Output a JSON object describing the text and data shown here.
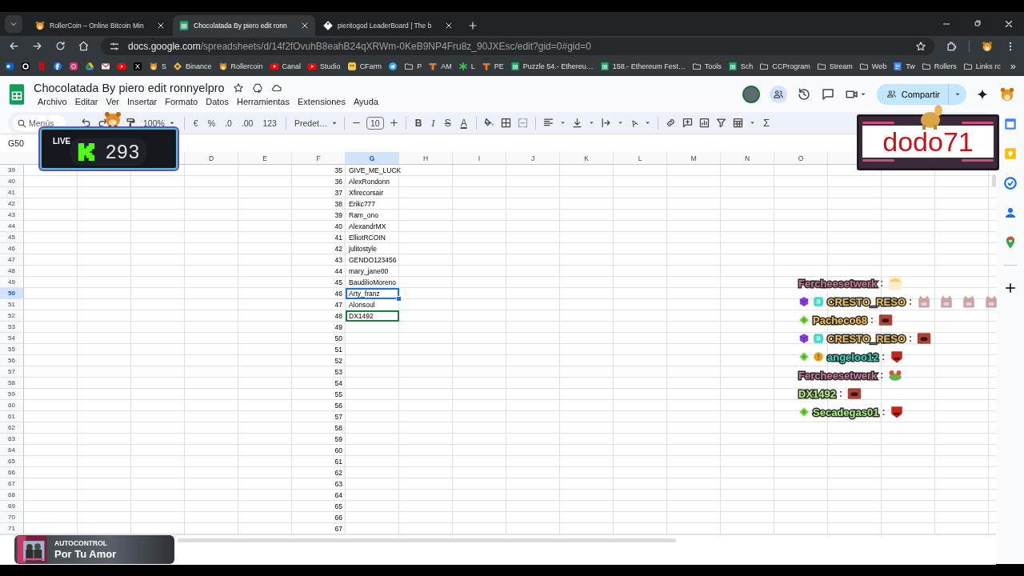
{
  "browser": {
    "tabs": [
      {
        "title": "RollerCoin – Online Bitcoin Min",
        "kind": "mascot",
        "selected": false
      },
      {
        "title": "Chocolatada By piero edit ronn",
        "kind": "sheet",
        "selected": true
      },
      {
        "title": "pieritogod LeaderBoard | The b",
        "kind": "tag",
        "selected": false
      }
    ],
    "address": {
      "host": "docs.google.com",
      "path": "/spreadsheets/d/14f2fOvuhB8eahB24qXRWm-0KeB9NP4Fru8z_90JXEsc/edit?gid=0#gid=0"
    },
    "bookmarks": [
      {
        "kind": "mail"
      },
      {
        "kind": "record"
      },
      {
        "kind": "redbar"
      },
      {
        "kind": "facebook"
      },
      {
        "kind": "camera"
      },
      {
        "kind": "drive"
      },
      {
        "kind": "envelope"
      },
      {
        "kind": "play"
      },
      {
        "kind": "xmark"
      },
      {
        "kind": "mascot",
        "label": "S"
      },
      {
        "kind": "diamond",
        "label": "Binance"
      },
      {
        "kind": "mascot",
        "label": "Rollercoin"
      },
      {
        "kind": "play",
        "label": "Canal"
      },
      {
        "kind": "play",
        "label": "Studio"
      },
      {
        "kind": "cfarm",
        "label": "CFarm"
      },
      {
        "kind": "plane"
      },
      {
        "kind": "folder",
        "label": "P"
      },
      {
        "kind": "tlogo",
        "label": "AM"
      },
      {
        "kind": "sparkle",
        "label": "L"
      },
      {
        "kind": "tlogo",
        "label": "PE"
      },
      {
        "kind": "sheet",
        "label": "Puzzle 54.- Ethereu…"
      },
      {
        "kind": "sheet",
        "label": "158.- Ethereum Fest…"
      },
      {
        "kind": "folder",
        "label": "Tools"
      },
      {
        "kind": "sheet",
        "label": "Sch"
      },
      {
        "kind": "folder",
        "label": "CCProgram"
      },
      {
        "kind": "folder",
        "label": "Stream"
      },
      {
        "kind": "folder",
        "label": "Web"
      },
      {
        "kind": "doc",
        "label": "Tw"
      },
      {
        "kind": "folder",
        "label": "Rollers"
      },
      {
        "kind": "folder",
        "label": "Links rc"
      }
    ],
    "bookmarks_overflow": "»"
  },
  "sheet": {
    "title": "Chocolatada By piero edit ronnyelpro",
    "menus": [
      "Archivo",
      "Editar",
      "Ver",
      "Insertar",
      "Formato",
      "Datos",
      "Herramientas",
      "Extensiones",
      "Ayuda"
    ],
    "share_button": "Compartir",
    "toolbar": {
      "search_placeholder": "Menús",
      "zoom": "100%",
      "currency": "€",
      "percent": "%",
      "decrease_decimals": ".0",
      "increase_decimals": ".00",
      "number_format": "123",
      "font": "Predet…",
      "font_size": "10",
      "bold": "B",
      "italic": "I",
      "strikethrough": "S",
      "text_color": "A",
      "rotate": "A",
      "sum": "Σ"
    },
    "name_box": "G50",
    "columns": [
      {
        "label": "D",
        "selected": false
      },
      {
        "label": "E",
        "selected": false
      },
      {
        "label": "F",
        "selected": false
      },
      {
        "label": "G",
        "selected": true
      },
      {
        "label": "H",
        "selected": false
      },
      {
        "label": "I",
        "selected": false
      },
      {
        "label": "J",
        "selected": false
      },
      {
        "label": "K",
        "selected": false
      },
      {
        "label": "L",
        "selected": false
      },
      {
        "label": "M",
        "selected": false
      },
      {
        "label": "N",
        "selected": false
      },
      {
        "label": "O",
        "selected": false
      }
    ],
    "rows": [
      {
        "number": "39",
        "f": "35",
        "g": "GIVE_ME_LUCK",
        "selected": false,
        "peer_cursor": false
      },
      {
        "number": "40",
        "f": "36",
        "g": "AlexRondonn",
        "selected": false,
        "peer_cursor": false
      },
      {
        "number": "41",
        "f": "37",
        "g": "Xfirecorsair",
        "selected": false,
        "peer_cursor": false
      },
      {
        "number": "42",
        "f": "38",
        "g": "Erikc777",
        "selected": false,
        "peer_cursor": false
      },
      {
        "number": "43",
        "f": "39",
        "g": "Ram_ono",
        "selected": false,
        "peer_cursor": false
      },
      {
        "number": "44",
        "f": "40",
        "g": "AlexandrMX",
        "selected": false,
        "peer_cursor": false
      },
      {
        "number": "45",
        "f": "41",
        "g": "ElliotRCOIN",
        "selected": false,
        "peer_cursor": false
      },
      {
        "number": "46",
        "f": "42",
        "g": "julitostyle",
        "selected": false,
        "peer_cursor": false
      },
      {
        "number": "47",
        "f": "43",
        "g": "GENDO123456",
        "selected": false,
        "peer_cursor": false
      },
      {
        "number": "48",
        "f": "44",
        "g": "mary_jane00",
        "selected": false,
        "peer_cursor": false
      },
      {
        "number": "49",
        "f": "45",
        "g": "BaudilioMoreno",
        "selected": false,
        "peer_cursor": false
      },
      {
        "number": "50",
        "f": "46",
        "g": "Arty_franz",
        "selected": true,
        "peer_cursor": false
      },
      {
        "number": "51",
        "f": "47",
        "g": "Alonsoul",
        "selected": false,
        "peer_cursor": false
      },
      {
        "number": "52",
        "f": "48",
        "g": "DX1492",
        "selected": false,
        "peer_cursor": true
      },
      {
        "number": "53",
        "f": "49",
        "selected": false,
        "peer_cursor": false
      },
      {
        "number": "54",
        "f": "50",
        "selected": false,
        "peer_cursor": false
      },
      {
        "number": "55",
        "f": "51",
        "selected": false,
        "peer_cursor": false
      },
      {
        "number": "56",
        "f": "52",
        "selected": false,
        "peer_cursor": false
      },
      {
        "number": "57",
        "f": "53",
        "selected": false,
        "peer_cursor": false
      },
      {
        "number": "58",
        "f": "54",
        "selected": false,
        "peer_cursor": false
      },
      {
        "number": "59",
        "f": "55",
        "selected": false,
        "peer_cursor": false
      },
      {
        "number": "60",
        "f": "56",
        "selected": false,
        "peer_cursor": false
      },
      {
        "number": "61",
        "f": "57",
        "selected": false,
        "peer_cursor": false
      },
      {
        "number": "62",
        "f": "58",
        "selected": false,
        "peer_cursor": false
      },
      {
        "number": "63",
        "f": "59",
        "selected": false,
        "peer_cursor": false
      },
      {
        "number": "64",
        "f": "60",
        "selected": false,
        "peer_cursor": false
      },
      {
        "number": "65",
        "f": "61",
        "selected": false,
        "peer_cursor": false
      },
      {
        "number": "66",
        "f": "62",
        "selected": false,
        "peer_cursor": false
      },
      {
        "number": "67",
        "f": "63",
        "selected": false,
        "peer_cursor": false
      },
      {
        "number": "68",
        "f": "64",
        "selected": false,
        "peer_cursor": false
      },
      {
        "number": "69",
        "f": "65",
        "selected": false,
        "peer_cursor": false
      },
      {
        "number": "70",
        "f": "66",
        "selected": false,
        "peer_cursor": false
      },
      {
        "number": "71",
        "f": "67",
        "selected": false,
        "peer_cursor": false
      }
    ]
  },
  "stream": {
    "live_badge": {
      "label": "LIVE",
      "viewers": "293"
    },
    "name_card": {
      "name": "dodo71"
    },
    "chat": [
      {
        "name": "Fercheesetwerk",
        "color": "#c9779a",
        "colon": ":",
        "emotes": [
          {
            "kind": "anime"
          }
        ]
      },
      {
        "name": "CRESTO_RESO",
        "color": "#f5c451",
        "badges": [
          {
            "kind": "cube"
          },
          {
            "kind": "bars"
          }
        ],
        "colon": ":",
        "emotes": [
          {
            "kind": "cat"
          },
          {
            "kind": "cat"
          },
          {
            "kind": "cat"
          },
          {
            "kind": "cat"
          }
        ]
      },
      {
        "name": "Pacheco68",
        "color": "#f5c451",
        "badges": [
          {
            "kind": "diamond"
          }
        ],
        "colon": ":",
        "emotes": [
          {
            "kind": "face"
          }
        ]
      },
      {
        "name": "CRESTO_RESO",
        "color": "#f5c451",
        "badges": [
          {
            "kind": "cube"
          },
          {
            "kind": "bars"
          }
        ],
        "colon": ":",
        "emotes": [
          {
            "kind": "face"
          }
        ]
      },
      {
        "name": "angeloo12",
        "color": "#3fd9c2",
        "badges": [
          {
            "kind": "diamond"
          },
          {
            "kind": "coin"
          }
        ],
        "colon": ":",
        "emotes": [
          {
            "kind": "mask"
          }
        ]
      },
      {
        "name": "Fercheesetwerk",
        "color": "#c9779a",
        "colon": ":",
        "emotes": [
          {
            "kind": "frog"
          }
        ]
      },
      {
        "name": "DX1492",
        "color": "#b9f28c",
        "colon": ":",
        "emotes": [
          {
            "kind": "face"
          }
        ]
      },
      {
        "name": "Secadegas01",
        "color": "#a9f07c",
        "badges": [
          {
            "kind": "diamond"
          }
        ],
        "colon": ":",
        "emotes": [
          {
            "kind": "mask"
          }
        ]
      }
    ],
    "now_playing": {
      "artist": "AUTOCONTROL",
      "song": "Por Tu Amor"
    }
  }
}
